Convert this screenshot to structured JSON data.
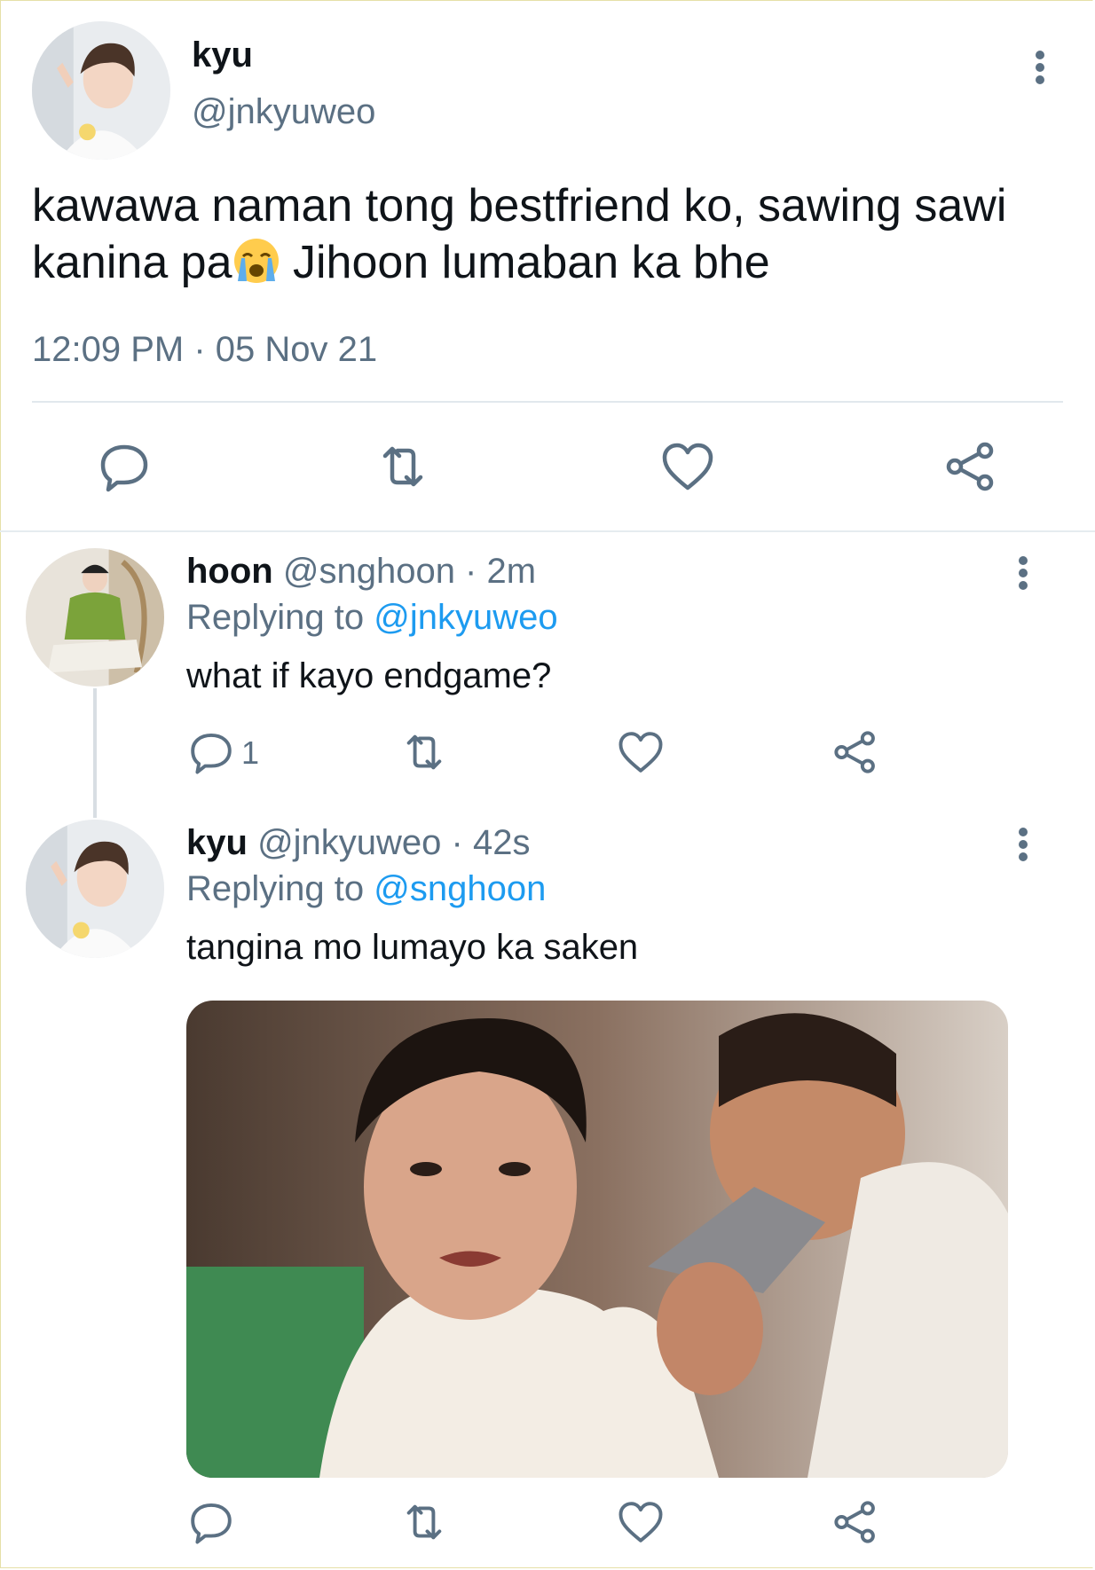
{
  "main_tweet": {
    "display_name": "kyu",
    "handle": "@jnkyuweo",
    "text_line1": "kawawa naman tong bestfriend ko, sawing sawi",
    "text_line2_pre": "kanina pa",
    "text_line2_post": " Jihoon lumaban ka bhe",
    "emoji": "crying-face",
    "time": "12:09 PM · 05 Nov 21",
    "actions": [
      "reply",
      "retweet",
      "like",
      "share"
    ]
  },
  "replies": [
    {
      "display_name": "hoon",
      "handle_time": "@snghoon · 2m",
      "replying_label": "Replying to",
      "replying_to": "@jnkyuweo",
      "text": "what if kayo endgame?",
      "reply_count": "1"
    },
    {
      "display_name": "kyu",
      "handle_time": "@jnkyuweo · 42s",
      "replying_label": "Replying to",
      "replying_to": "@snghoon",
      "text": "tangina mo lumayo ka saken",
      "media": "image-attachment"
    }
  ],
  "colors": {
    "text": "#0f1419",
    "secondary": "#5b7083",
    "link": "#1d9bf0",
    "divider": "#e1e8ed"
  }
}
